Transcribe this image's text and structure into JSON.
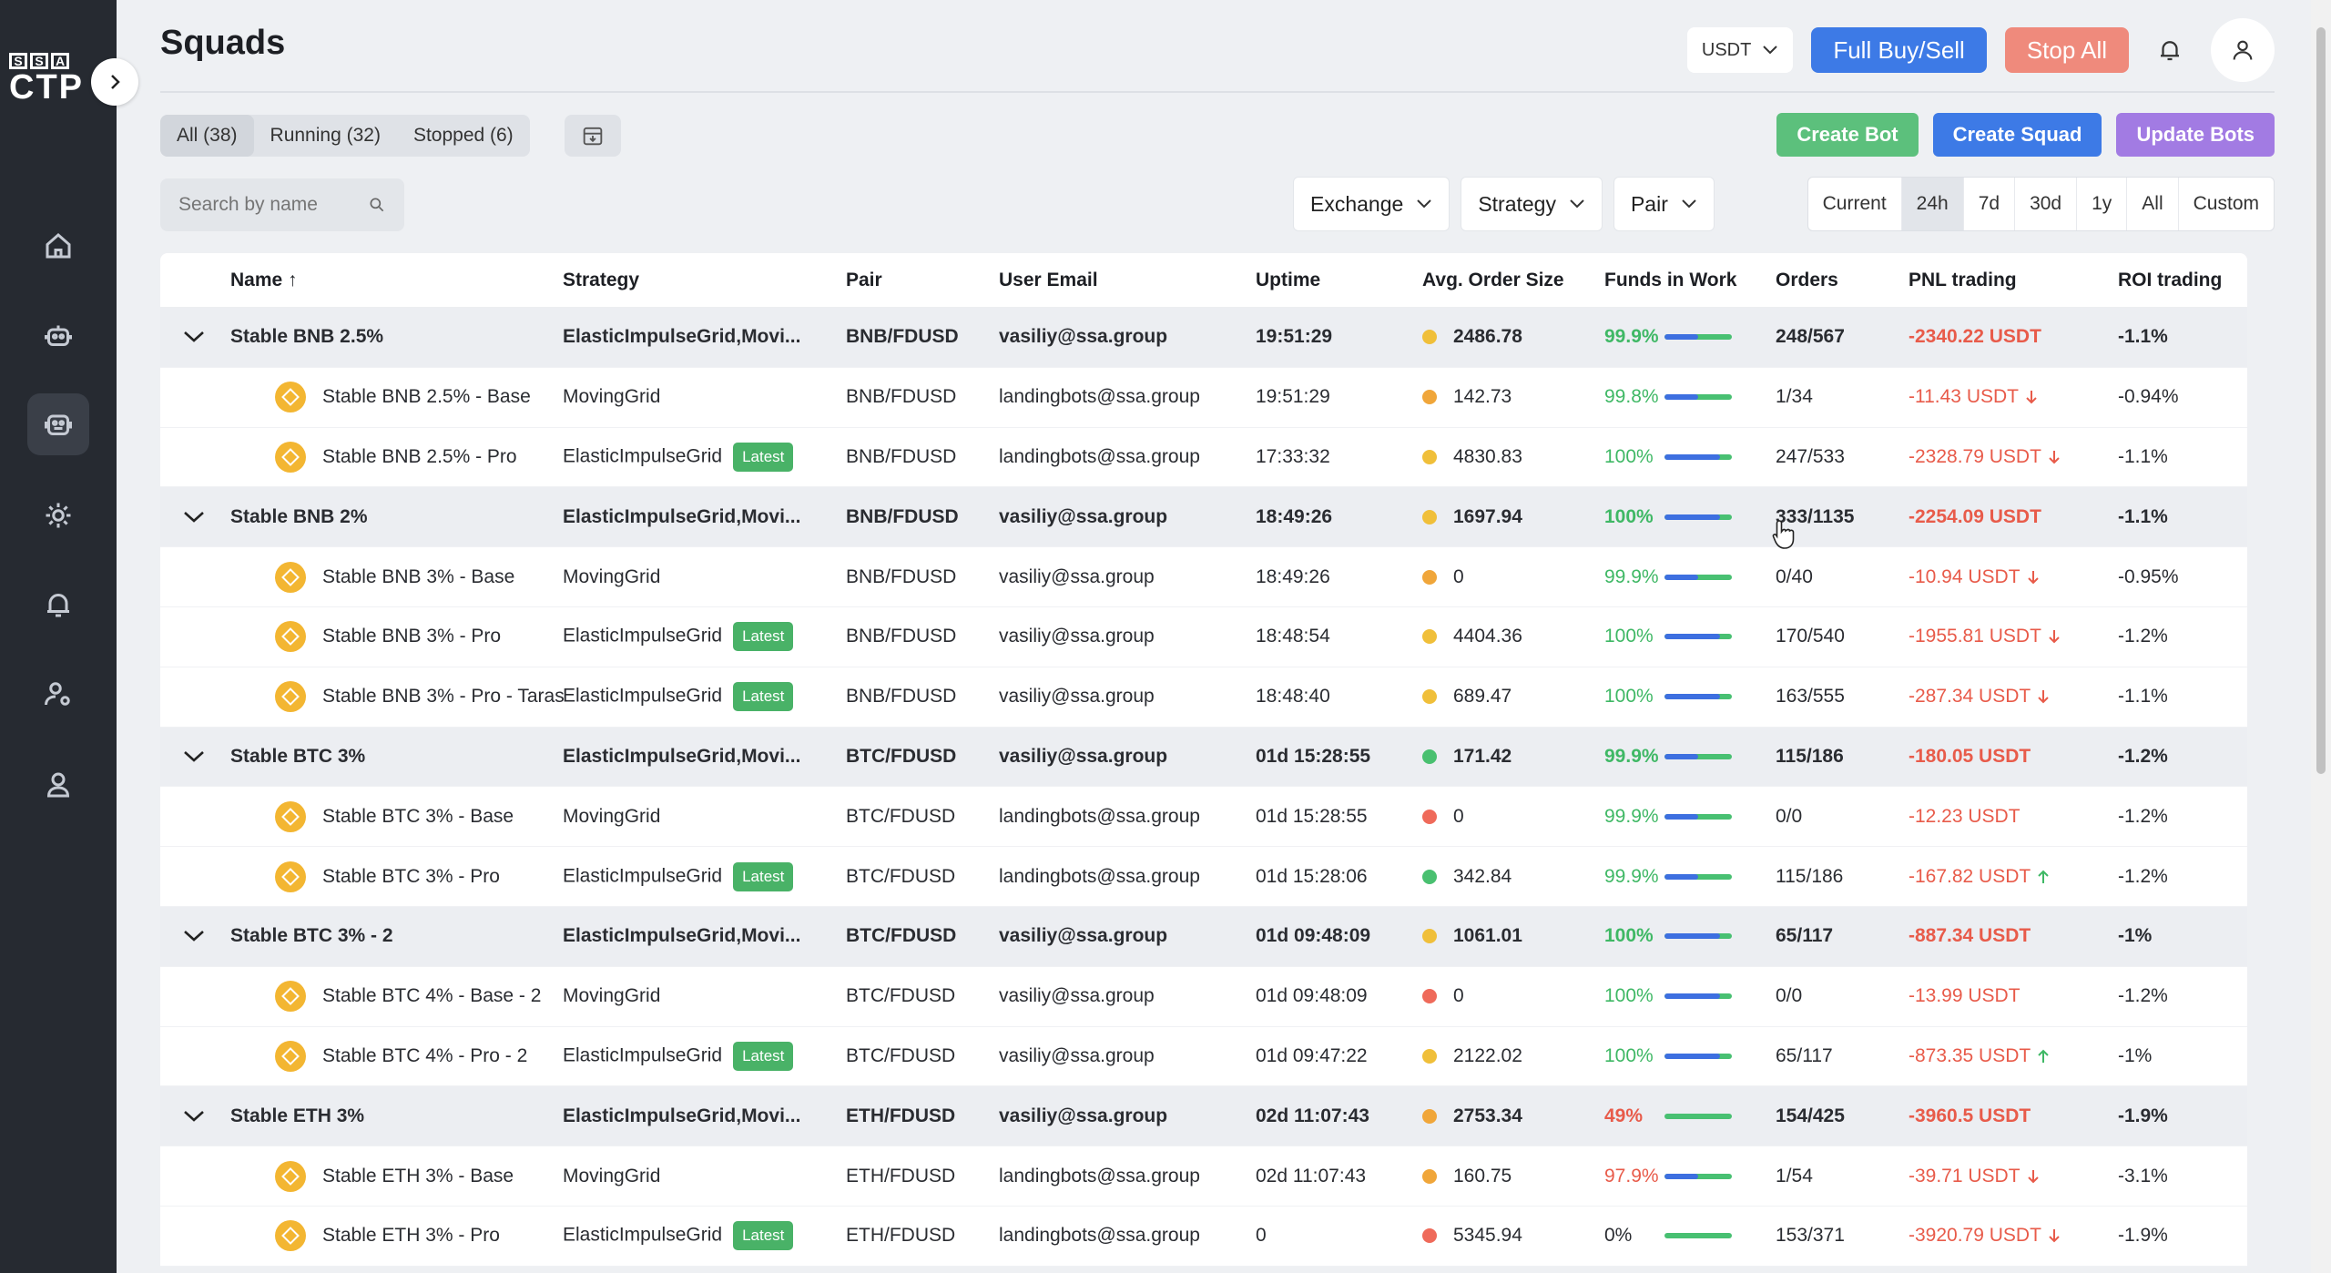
{
  "logo": {
    "top": [
      "S",
      "S",
      "A"
    ],
    "bottom": "CTP"
  },
  "header": {
    "title": "Squads",
    "currency": "USDT",
    "full_buy_sell": "Full Buy/Sell",
    "stop_all": "Stop All"
  },
  "tabs": [
    {
      "label": "All (38)",
      "active": true
    },
    {
      "label": "Running (32)",
      "active": false
    },
    {
      "label": "Stopped (6)",
      "active": false
    }
  ],
  "actions": {
    "create_bot": "Create Bot",
    "create_squad": "Create Squad",
    "update_bots": "Update Bots"
  },
  "search": {
    "placeholder": "Search by name"
  },
  "filters": {
    "exchange": "Exchange",
    "strategy": "Strategy",
    "pair": "Pair"
  },
  "periods": [
    {
      "label": "Current",
      "active": false
    },
    {
      "label": "24h",
      "active": true
    },
    {
      "label": "7d",
      "active": false
    },
    {
      "label": "30d",
      "active": false
    },
    {
      "label": "1y",
      "active": false
    },
    {
      "label": "All",
      "active": false
    },
    {
      "label": "Custom",
      "active": false
    }
  ],
  "columns": {
    "name": "Name",
    "strategy": "Strategy",
    "pair": "Pair",
    "email": "User Email",
    "uptime": "Uptime",
    "avg": "Avg. Order Size",
    "funds": "Funds in Work",
    "orders": "Orders",
    "pnl": "PNL trading",
    "roi": "ROI trading"
  },
  "colors": {
    "yellow_dot": "#f0bf3a",
    "red_dot": "#ef6a5a",
    "green_dot": "#49c070",
    "pnl_red": "#e85b4a",
    "pct_green": "#3fb865"
  },
  "rows": [
    {
      "group": true,
      "name": "Stable BNB 2.5%",
      "strategy": "ElasticImpulseGrid,Movi...",
      "pair": "BNB/FDUSD",
      "email": "vasiliy@ssa.group",
      "uptime": "19:51:29",
      "dot": "yellow",
      "avg": "2486.78",
      "funds": "99.9%",
      "funds_pct": 0.999,
      "orders": "248/567",
      "pnl": "-2340.22 USDT",
      "arrow": "",
      "roi": "-1.1%"
    },
    {
      "group": false,
      "name": "Stable BNB 2.5% - Base",
      "strategy": "MovingGrid",
      "latest": false,
      "pair": "BNB/FDUSD",
      "email": "landingbots@ssa.group",
      "uptime": "19:51:29",
      "dot": "orange",
      "avg": "142.73",
      "funds": "99.8%",
      "funds_pct": 0.998,
      "orders": "1/34",
      "pnl": "-11.43 USDT",
      "arrow": "down",
      "roi": "-0.94%"
    },
    {
      "group": false,
      "name": "Stable BNB 2.5% - Pro",
      "strategy": "ElasticImpulseGrid",
      "latest": true,
      "pair": "BNB/FDUSD",
      "email": "landingbots@ssa.group",
      "uptime": "17:33:32",
      "dot": "yellow",
      "avg": "4830.83",
      "funds": "100%",
      "funds_pct": 1.0,
      "orders": "247/533",
      "pnl": "-2328.79 USDT",
      "arrow": "down",
      "roi": "-1.1%"
    },
    {
      "group": true,
      "name": "Stable BNB 2%",
      "strategy": "ElasticImpulseGrid,Movi...",
      "pair": "BNB/FDUSD",
      "email": "vasiliy@ssa.group",
      "uptime": "18:49:26",
      "dot": "yellow",
      "avg": "1697.94",
      "funds": "100%",
      "funds_pct": 1.0,
      "orders": "333/1135",
      "pnl": "-2254.09 USDT",
      "arrow": "",
      "roi": "-1.1%"
    },
    {
      "group": false,
      "name": "Stable BNB 3% - Base",
      "strategy": "MovingGrid",
      "latest": false,
      "pair": "BNB/FDUSD",
      "email": "vasiliy@ssa.group",
      "uptime": "18:49:26",
      "dot": "orange",
      "avg": "0",
      "funds": "99.9%",
      "funds_pct": 0.999,
      "orders": "0/40",
      "pnl": "-10.94 USDT",
      "arrow": "down",
      "roi": "-0.95%"
    },
    {
      "group": false,
      "name": "Stable BNB 3% - Pro",
      "strategy": "ElasticImpulseGrid",
      "latest": true,
      "pair": "BNB/FDUSD",
      "email": "vasiliy@ssa.group",
      "uptime": "18:48:54",
      "dot": "yellow",
      "avg": "4404.36",
      "funds": "100%",
      "funds_pct": 1.0,
      "orders": "170/540",
      "pnl": "-1955.81 USDT",
      "arrow": "down",
      "roi": "-1.2%"
    },
    {
      "group": false,
      "name": "Stable BNB 3% - Pro - Taras",
      "strategy": "ElasticImpulseGrid",
      "latest": true,
      "pair": "BNB/FDUSD",
      "email": "vasiliy@ssa.group",
      "uptime": "18:48:40",
      "dot": "yellow",
      "avg": "689.47",
      "funds": "100%",
      "funds_pct": 1.0,
      "orders": "163/555",
      "pnl": "-287.34 USDT",
      "arrow": "down",
      "roi": "-1.1%"
    },
    {
      "group": true,
      "name": "Stable BTC 3%",
      "strategy": "ElasticImpulseGrid,Movi...",
      "pair": "BTC/FDUSD",
      "email": "vasiliy@ssa.group",
      "uptime": "01d 15:28:55",
      "dot": "green",
      "avg": "171.42",
      "funds": "99.9%",
      "funds_pct": 0.999,
      "orders": "115/186",
      "pnl": "-180.05 USDT",
      "arrow": "",
      "roi": "-1.2%"
    },
    {
      "group": false,
      "name": "Stable BTC 3% - Base",
      "strategy": "MovingGrid",
      "latest": false,
      "pair": "BTC/FDUSD",
      "email": "landingbots@ssa.group",
      "uptime": "01d 15:28:55",
      "dot": "red",
      "avg": "0",
      "funds": "99.9%",
      "funds_pct": 0.999,
      "orders": "0/0",
      "pnl": "-12.23 USDT",
      "arrow": "",
      "roi": "-1.2%"
    },
    {
      "group": false,
      "name": "Stable BTC 3% - Pro",
      "strategy": "ElasticImpulseGrid",
      "latest": true,
      "pair": "BTC/FDUSD",
      "email": "landingbots@ssa.group",
      "uptime": "01d 15:28:06",
      "dot": "green",
      "avg": "342.84",
      "funds": "99.9%",
      "funds_pct": 0.999,
      "orders": "115/186",
      "pnl": "-167.82 USDT",
      "arrow": "up",
      "roi": "-1.2%"
    },
    {
      "group": true,
      "name": "Stable BTC 3% - 2",
      "strategy": "ElasticImpulseGrid,Movi...",
      "pair": "BTC/FDUSD",
      "email": "vasiliy@ssa.group",
      "uptime": "01d 09:48:09",
      "dot": "yellow",
      "avg": "1061.01",
      "funds": "100%",
      "funds_pct": 1.0,
      "orders": "65/117",
      "pnl": "-887.34 USDT",
      "arrow": "",
      "roi": "-1%"
    },
    {
      "group": false,
      "name": "Stable BTC 4% - Base - 2",
      "strategy": "MovingGrid",
      "latest": false,
      "pair": "BTC/FDUSD",
      "email": "vasiliy@ssa.group",
      "uptime": "01d 09:48:09",
      "dot": "red",
      "avg": "0",
      "funds": "100%",
      "funds_pct": 1.0,
      "orders": "0/0",
      "pnl": "-13.99 USDT",
      "arrow": "",
      "roi": "-1.2%"
    },
    {
      "group": false,
      "name": "Stable BTC 4% - Pro - 2",
      "strategy": "ElasticImpulseGrid",
      "latest": true,
      "pair": "BTC/FDUSD",
      "email": "vasiliy@ssa.group",
      "uptime": "01d 09:47:22",
      "dot": "yellow",
      "avg": "2122.02",
      "funds": "100%",
      "funds_pct": 1.0,
      "orders": "65/117",
      "pnl": "-873.35 USDT",
      "arrow": "up",
      "roi": "-1%"
    },
    {
      "group": true,
      "name": "Stable ETH 3%",
      "strategy": "ElasticImpulseGrid,Movi...",
      "pair": "ETH/FDUSD",
      "email": "vasiliy@ssa.group",
      "uptime": "02d 11:07:43",
      "dot": "orange",
      "avg": "2753.34",
      "funds": "49%",
      "funds_pct": 0.49,
      "funds_red": true,
      "orders": "154/425",
      "pnl": "-3960.5 USDT",
      "arrow": "",
      "roi": "-1.9%"
    },
    {
      "group": false,
      "name": "Stable ETH 3% - Base",
      "strategy": "MovingGrid",
      "latest": false,
      "pair": "ETH/FDUSD",
      "email": "landingbots@ssa.group",
      "uptime": "02d 11:07:43",
      "dot": "orange",
      "avg": "160.75",
      "funds": "97.9%",
      "funds_pct": 0.979,
      "funds_red": true,
      "orders": "1/54",
      "pnl": "-39.71 USDT",
      "arrow": "down",
      "roi": "-3.1%"
    },
    {
      "group": false,
      "name": "Stable ETH 3% - Pro",
      "strategy": "ElasticImpulseGrid",
      "latest": true,
      "pair": "ETH/FDUSD",
      "email": "landingbots@ssa.group",
      "uptime": "0",
      "dot": "red",
      "avg": "5345.94",
      "funds": "0%",
      "funds_pct": 0.0,
      "funds_gray": true,
      "orders": "153/371",
      "pnl": "-3920.79 USDT",
      "arrow": "down",
      "roi": "-1.9%"
    }
  ],
  "latest_label": "Latest"
}
